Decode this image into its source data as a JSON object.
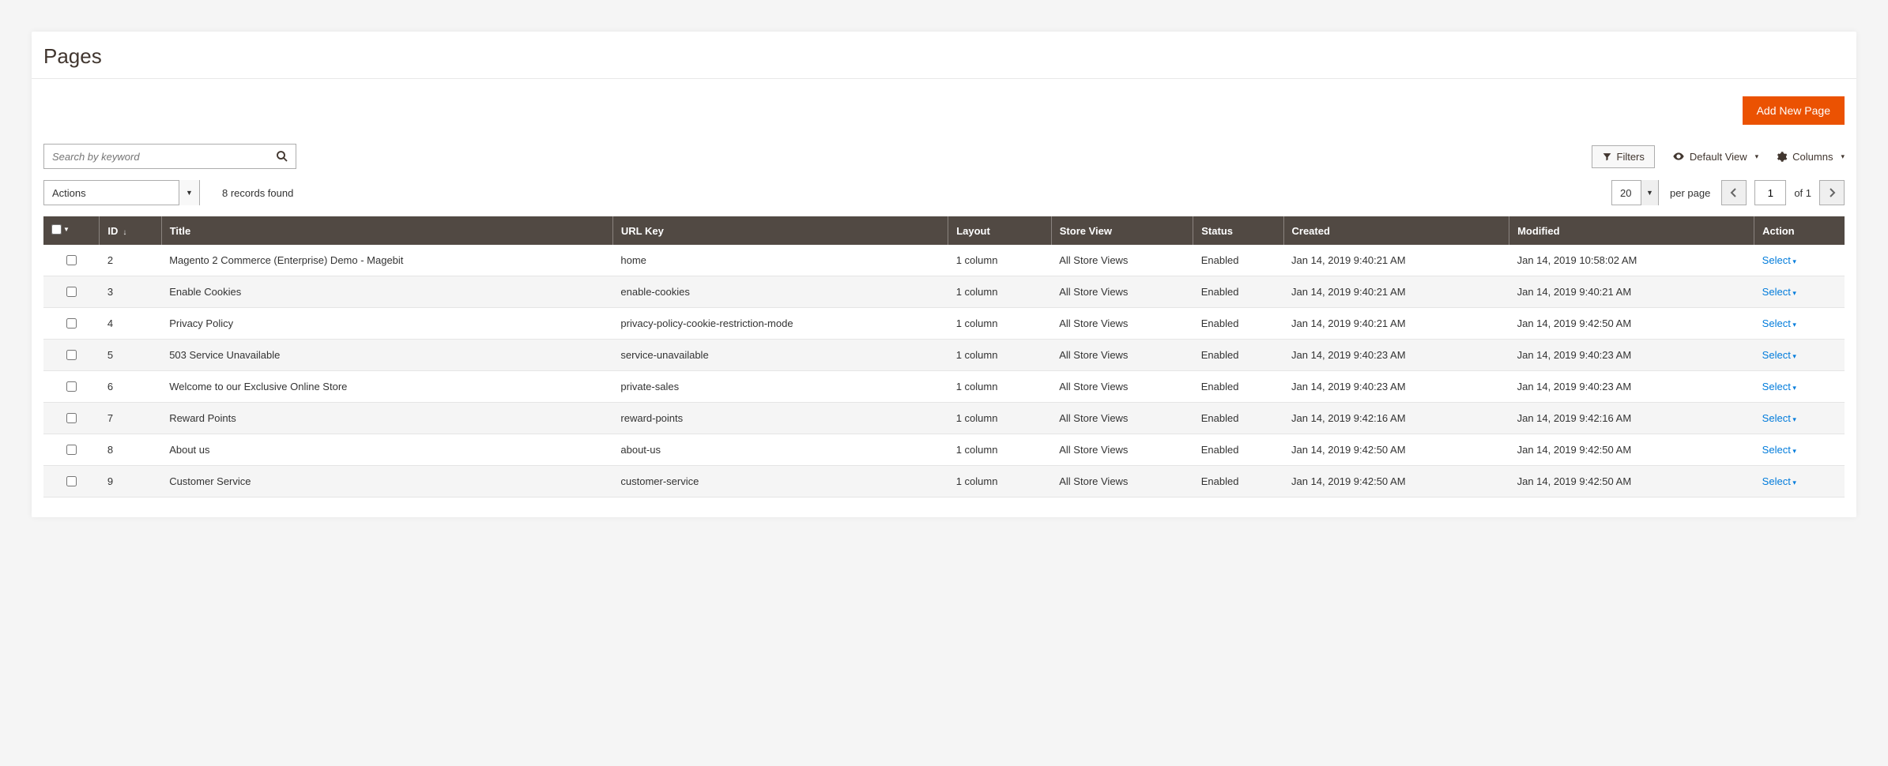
{
  "page": {
    "title": "Pages",
    "add_button": "Add New Page"
  },
  "search": {
    "placeholder": "Search by keyword"
  },
  "toolbar": {
    "filters": "Filters",
    "default_view": "Default View",
    "columns": "Columns"
  },
  "actions": {
    "label": "Actions",
    "records_found": "8 records found"
  },
  "pagination": {
    "per_page_value": "20",
    "per_page_label": "per page",
    "current": "1",
    "of_label": "of 1"
  },
  "columns": {
    "id": "ID",
    "title": "Title",
    "url_key": "URL Key",
    "layout": "Layout",
    "store_view": "Store View",
    "status": "Status",
    "created": "Created",
    "modified": "Modified",
    "action": "Action"
  },
  "row_action": "Select",
  "rows": [
    {
      "id": "2",
      "title": "Magento 2 Commerce (Enterprise) Demo - Magebit",
      "url_key": "home",
      "layout": "1 column",
      "store_view": "All Store Views",
      "status": "Enabled",
      "created": "Jan 14, 2019 9:40:21 AM",
      "modified": "Jan 14, 2019 10:58:02 AM"
    },
    {
      "id": "3",
      "title": "Enable Cookies",
      "url_key": "enable-cookies",
      "layout": "1 column",
      "store_view": "All Store Views",
      "status": "Enabled",
      "created": "Jan 14, 2019 9:40:21 AM",
      "modified": "Jan 14, 2019 9:40:21 AM"
    },
    {
      "id": "4",
      "title": "Privacy Policy",
      "url_key": "privacy-policy-cookie-restriction-mode",
      "layout": "1 column",
      "store_view": "All Store Views",
      "status": "Enabled",
      "created": "Jan 14, 2019 9:40:21 AM",
      "modified": "Jan 14, 2019 9:42:50 AM"
    },
    {
      "id": "5",
      "title": "503 Service Unavailable",
      "url_key": "service-unavailable",
      "layout": "1 column",
      "store_view": "All Store Views",
      "status": "Enabled",
      "created": "Jan 14, 2019 9:40:23 AM",
      "modified": "Jan 14, 2019 9:40:23 AM"
    },
    {
      "id": "6",
      "title": "Welcome to our Exclusive Online Store",
      "url_key": "private-sales",
      "layout": "1 column",
      "store_view": "All Store Views",
      "status": "Enabled",
      "created": "Jan 14, 2019 9:40:23 AM",
      "modified": "Jan 14, 2019 9:40:23 AM"
    },
    {
      "id": "7",
      "title": "Reward Points",
      "url_key": "reward-points",
      "layout": "1 column",
      "store_view": "All Store Views",
      "status": "Enabled",
      "created": "Jan 14, 2019 9:42:16 AM",
      "modified": "Jan 14, 2019 9:42:16 AM"
    },
    {
      "id": "8",
      "title": "About us",
      "url_key": "about-us",
      "layout": "1 column",
      "store_view": "All Store Views",
      "status": "Enabled",
      "created": "Jan 14, 2019 9:42:50 AM",
      "modified": "Jan 14, 2019 9:42:50 AM"
    },
    {
      "id": "9",
      "title": "Customer Service",
      "url_key": "customer-service",
      "layout": "1 column",
      "store_view": "All Store Views",
      "status": "Enabled",
      "created": "Jan 14, 2019 9:42:50 AM",
      "modified": "Jan 14, 2019 9:42:50 AM"
    }
  ]
}
